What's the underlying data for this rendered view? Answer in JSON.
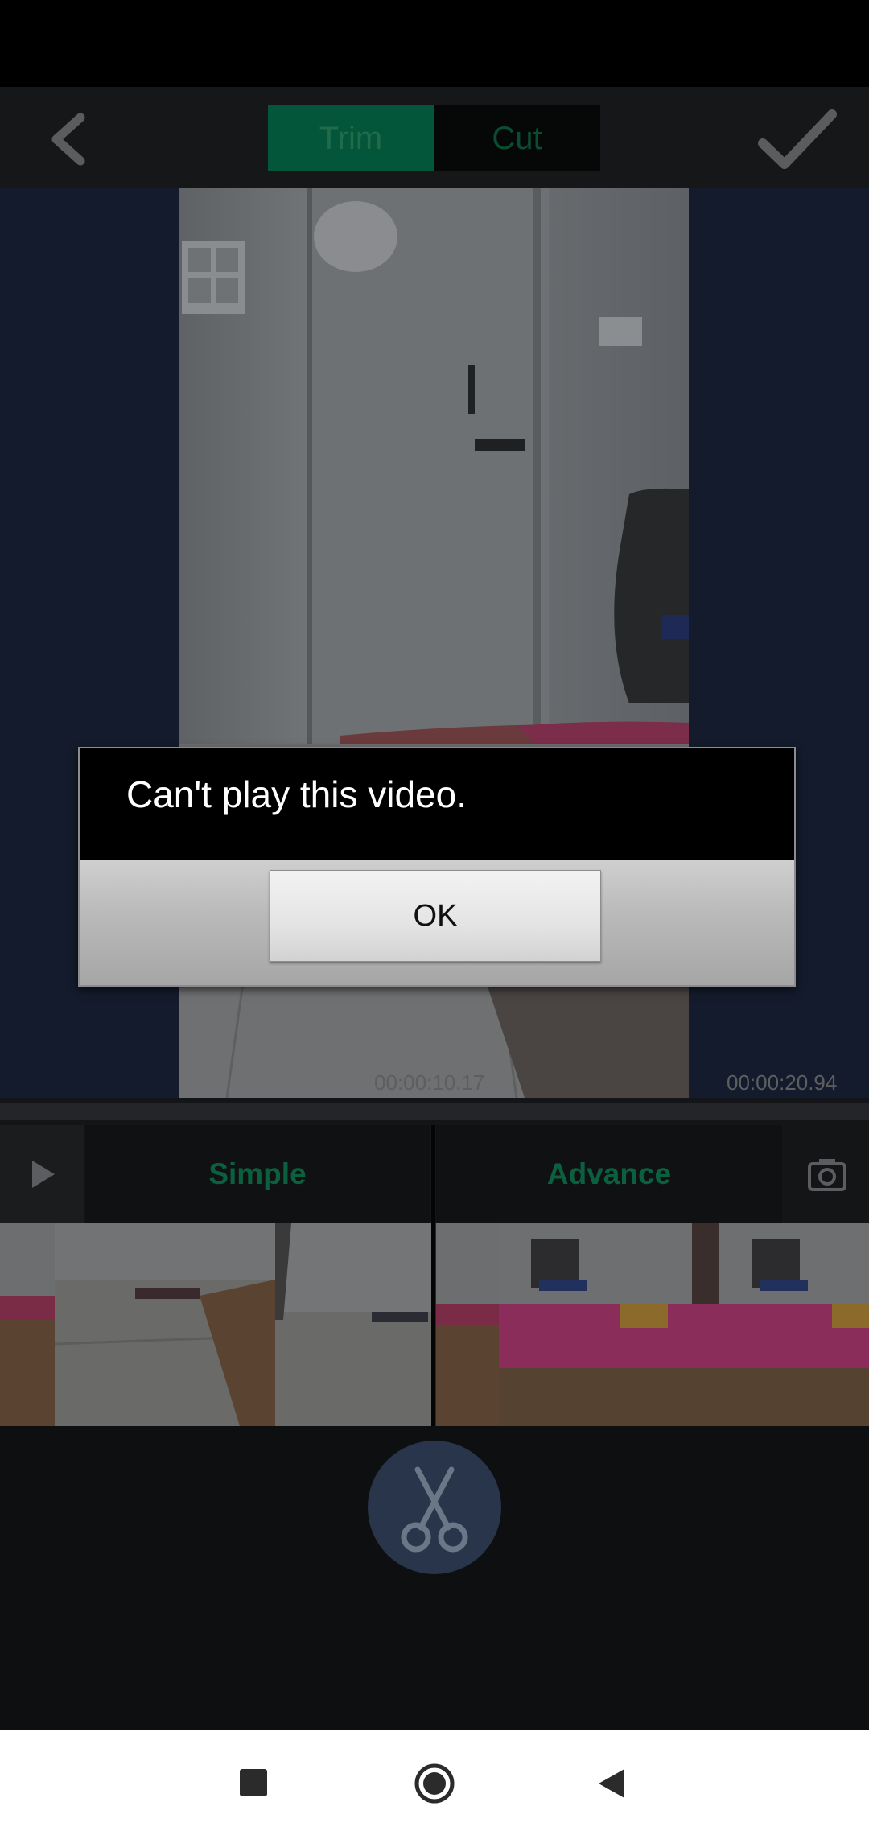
{
  "toolbar": {
    "tabs": [
      {
        "label": "Trim",
        "selected": true
      },
      {
        "label": "Cut",
        "selected": false
      }
    ],
    "back_icon": "chevron-left-icon",
    "confirm_icon": "checkmark-icon"
  },
  "player": {
    "current_time": "00:00:10.17",
    "total_time": "00:00:20.94"
  },
  "modes": {
    "simple_label": "Simple",
    "advance_label": "Advance",
    "play_icon": "play-icon",
    "camera_icon": "camera-icon"
  },
  "cut_action": {
    "icon": "scissors-icon"
  },
  "dialog": {
    "message": "Can't play this video.",
    "ok_label": "OK"
  },
  "nav_bar": {
    "icons": [
      "recent-apps-square-icon",
      "home-circle-icon",
      "back-triangle-icon"
    ]
  },
  "colors": {
    "accent_green": "#04563a",
    "overlay_dim": "#141518",
    "cut_button": "#28354b"
  }
}
